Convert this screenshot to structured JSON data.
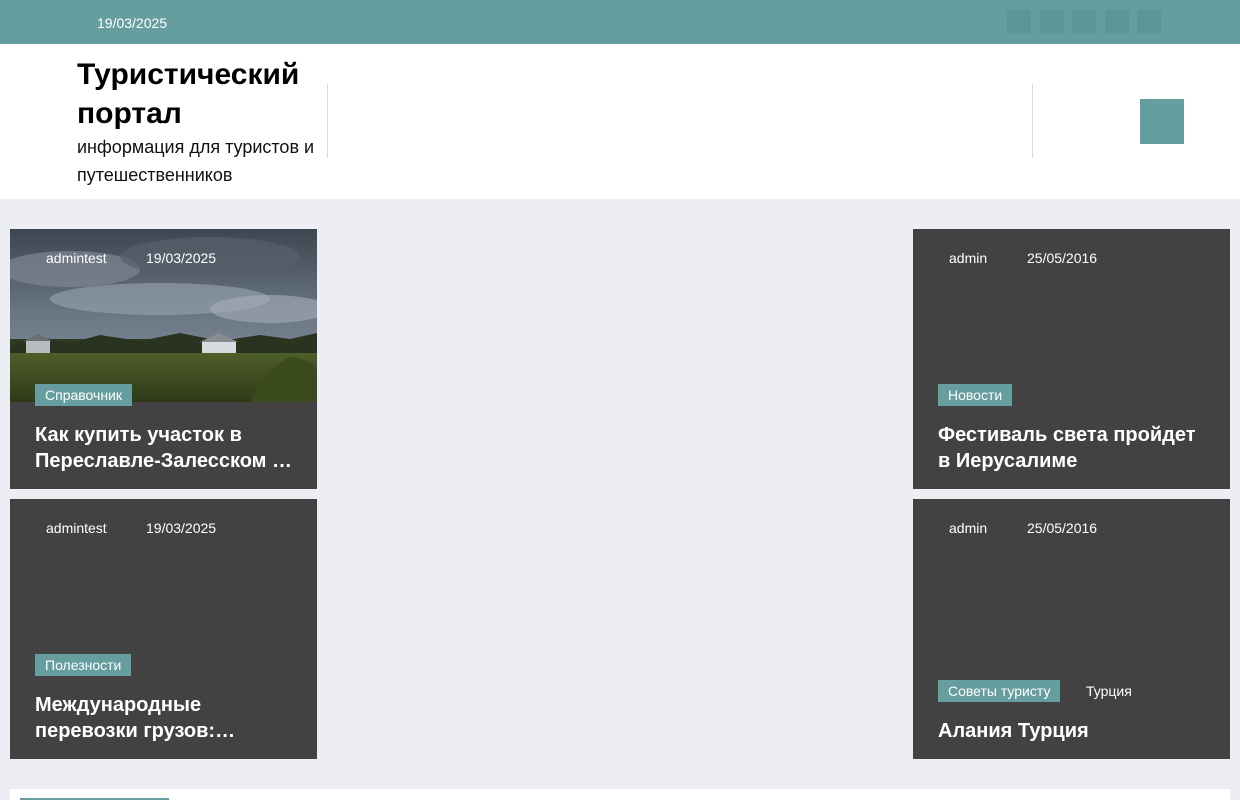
{
  "topbar": {
    "date": "19/03/2025",
    "social_icons": [
      "social-icon-1",
      "social-icon-2",
      "social-icon-3",
      "social-icon-4",
      "social-icon-5"
    ]
  },
  "header": {
    "title": "Туристический портал",
    "description": "информация для туристов и путешественников",
    "menu_icon": "menu-icon"
  },
  "colors": {
    "accent": "#669e9f",
    "card_bg": "#424242",
    "page_bg": "#eceef3"
  },
  "posts": [
    {
      "author": "admintest",
      "date": "19/03/2025",
      "category": "Справочник",
      "title": "Как купить участок в Переславле-Залесском и построить дом",
      "has_image": true
    },
    {
      "author": "admin",
      "date": "25/05/2016",
      "category": "Новости",
      "title": "Фестиваль света пройдет в Иерусалиме"
    },
    {
      "author": "admintest",
      "date": "19/03/2025",
      "category": "Полезности",
      "title": "Международные перевозки грузов: особенности и преимущества"
    },
    {
      "author": "admin",
      "date": "25/05/2016",
      "category": "Советы туристу",
      "tag": "Турция",
      "title": "Алания Турция"
    }
  ]
}
